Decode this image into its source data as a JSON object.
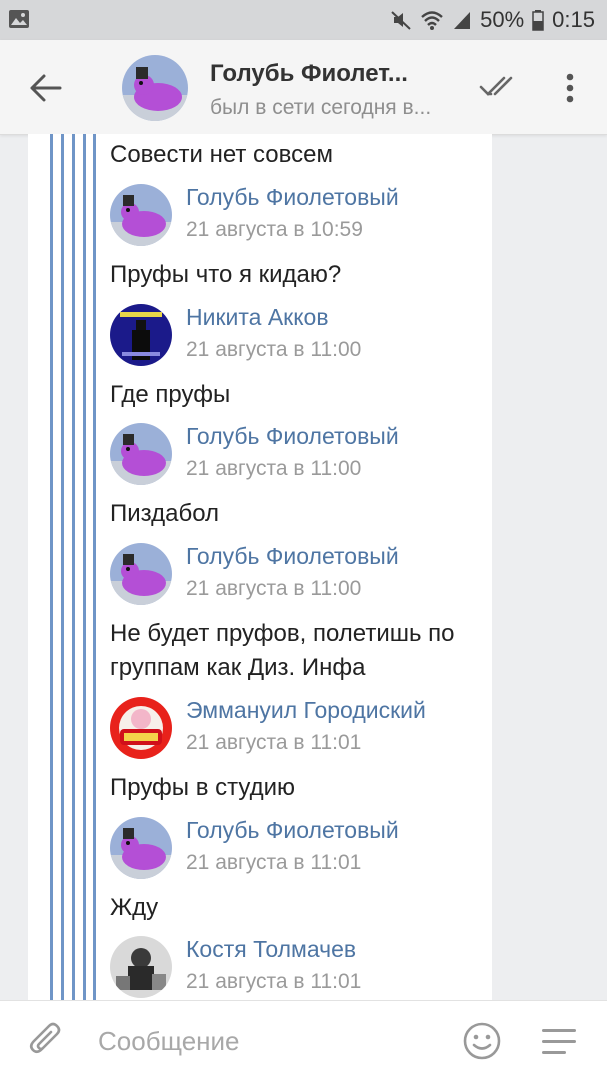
{
  "status_bar": {
    "battery": "50%",
    "time": "0:15",
    "icons": [
      "image-icon",
      "mute-icon",
      "wifi-icon",
      "signal-icon",
      "battery-icon"
    ]
  },
  "header": {
    "back_icon": "arrow-left-icon",
    "title": "Голубь Фиолет...",
    "subtitle": "был в сети сегодня в...",
    "read_icon": "double-check-icon",
    "more_icon": "more-vertical-icon"
  },
  "conversation": {
    "top_text": "Совести нет совсем",
    "messages": [
      {
        "author": "Голубь Фиолетовый",
        "date": "21 августа в 10:59",
        "text": "Пруфы что я кидаю?",
        "avatar": "pigeon"
      },
      {
        "author": "Никита Акков",
        "date": "21 августа в 11:00",
        "text": "Где пруфы",
        "avatar": "dark"
      },
      {
        "author": "Голубь Фиолетовый",
        "date": "21 августа в 11:00",
        "text": "Пиздабол",
        "avatar": "pigeon"
      },
      {
        "author": "Голубь Фиолетовый",
        "date": "21 августа в 11:00",
        "text": "Не будет пруфов, полетишь по группам как Диз. Инфа",
        "avatar": "pigeon"
      },
      {
        "author": "Эммануил Городиский",
        "date": "21 августа в 11:01",
        "text": "Пруфы в студию",
        "avatar": "emic"
      },
      {
        "author": "Голубь Фиолетовый",
        "date": "21 августа в 11:01",
        "text": "Жду",
        "avatar": "pigeon"
      },
      {
        "author": "Костя Толмачев",
        "date": "21 августа в 11:01",
        "text": "",
        "avatar": "bw"
      }
    ]
  },
  "composer": {
    "placeholder": "Сообщение",
    "value": "",
    "attach_icon": "paperclip-icon",
    "emoji_icon": "smiley-icon",
    "menu_icon": "menu-lines-icon"
  },
  "colors": {
    "accent": "#4e75a3",
    "stripe": "#6f95c7",
    "background": "#edeef0"
  }
}
